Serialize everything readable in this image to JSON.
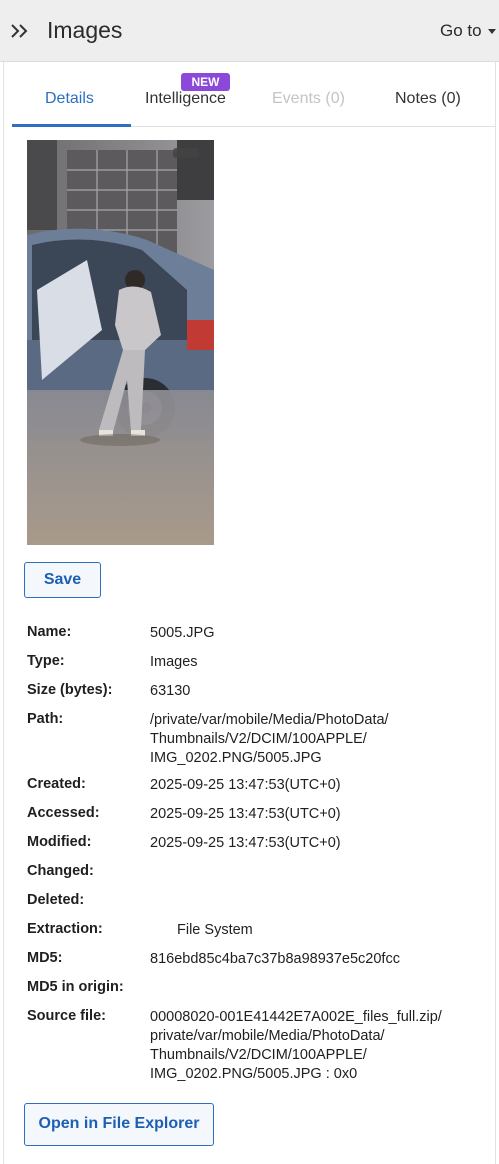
{
  "header": {
    "title": "Images",
    "goto_label": "Go to"
  },
  "tabs": [
    {
      "label": "Details",
      "active": true
    },
    {
      "label": "Intelligence",
      "badge": "NEW"
    },
    {
      "label": "Events (0)",
      "disabled": true
    },
    {
      "label": "Notes (0)"
    }
  ],
  "actions": {
    "save_label": "Save",
    "open_label": "Open in File Explorer"
  },
  "properties": {
    "name": {
      "label": "Name:",
      "value": "5005.JPG"
    },
    "type": {
      "label": "Type:",
      "value": "Images"
    },
    "size": {
      "label": "Size (bytes):",
      "value": "63130"
    },
    "path": {
      "label": "Path:",
      "value": "/private/var/mobile/Media/PhotoData/\nThumbnails/V2/DCIM/100APPLE/\nIMG_0202.PNG/5005.JPG"
    },
    "created": {
      "label": "Created:",
      "value": "2025-09-25 13:47:53(UTC+0)"
    },
    "accessed": {
      "label": "Accessed:",
      "value": "2025-09-25 13:47:53(UTC+0)"
    },
    "modified": {
      "label": "Modified:",
      "value": "2025-09-25 13:47:53(UTC+0)"
    },
    "changed": {
      "label": "Changed:",
      "value": ""
    },
    "deleted": {
      "label": "Deleted:",
      "value": ""
    },
    "extraction": {
      "label": "Extraction:",
      "value": "File System"
    },
    "md5": {
      "label": "MD5:",
      "value": "816ebd85c4ba7c37b8a98937e5c20fcc"
    },
    "md5_origin": {
      "label": "MD5 in origin:",
      "value": ""
    },
    "source_file": {
      "label": "Source file:",
      "value": "00008020-001E41442E7A002E_files_full.zip/\nprivate/var/mobile/Media/PhotoData/\nThumbnails/V2/DCIM/100APPLE/\nIMG_0202.PNG/5005.JPG : 0x0"
    }
  },
  "colors": {
    "accent": "#2f6fbf",
    "badge": "#8c49d9",
    "header_bg": "#eeeeee"
  }
}
